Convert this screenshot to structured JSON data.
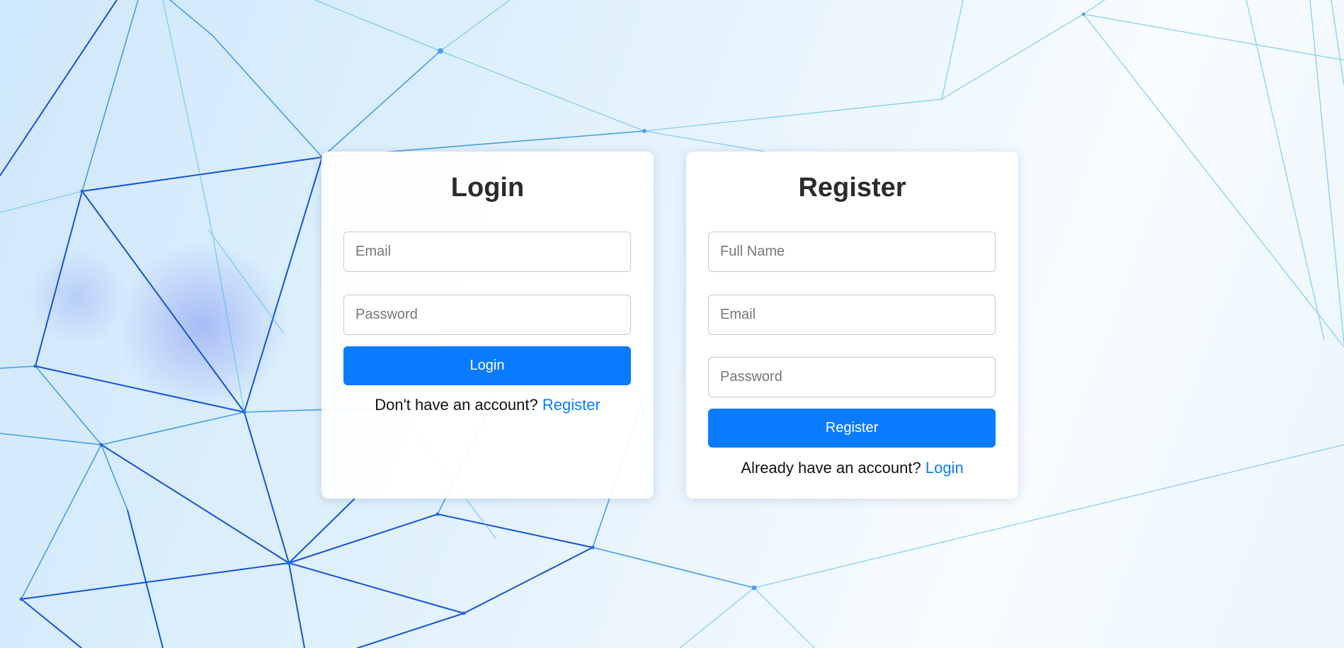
{
  "login": {
    "title": "Login",
    "email_placeholder": "Email",
    "password_placeholder": "Password",
    "button_label": "Login",
    "prompt_text": "Don't have an account?",
    "link_text": "Register"
  },
  "register": {
    "title": "Register",
    "fullname_placeholder": "Full Name",
    "email_placeholder": "Email",
    "password_placeholder": "Password",
    "button_label": "Register",
    "prompt_text": "Already have an account?",
    "link_text": "Login"
  },
  "colors": {
    "accent": "#0a7bff",
    "heading": "#2b2b2b",
    "network_line": "#1f6fe0"
  }
}
